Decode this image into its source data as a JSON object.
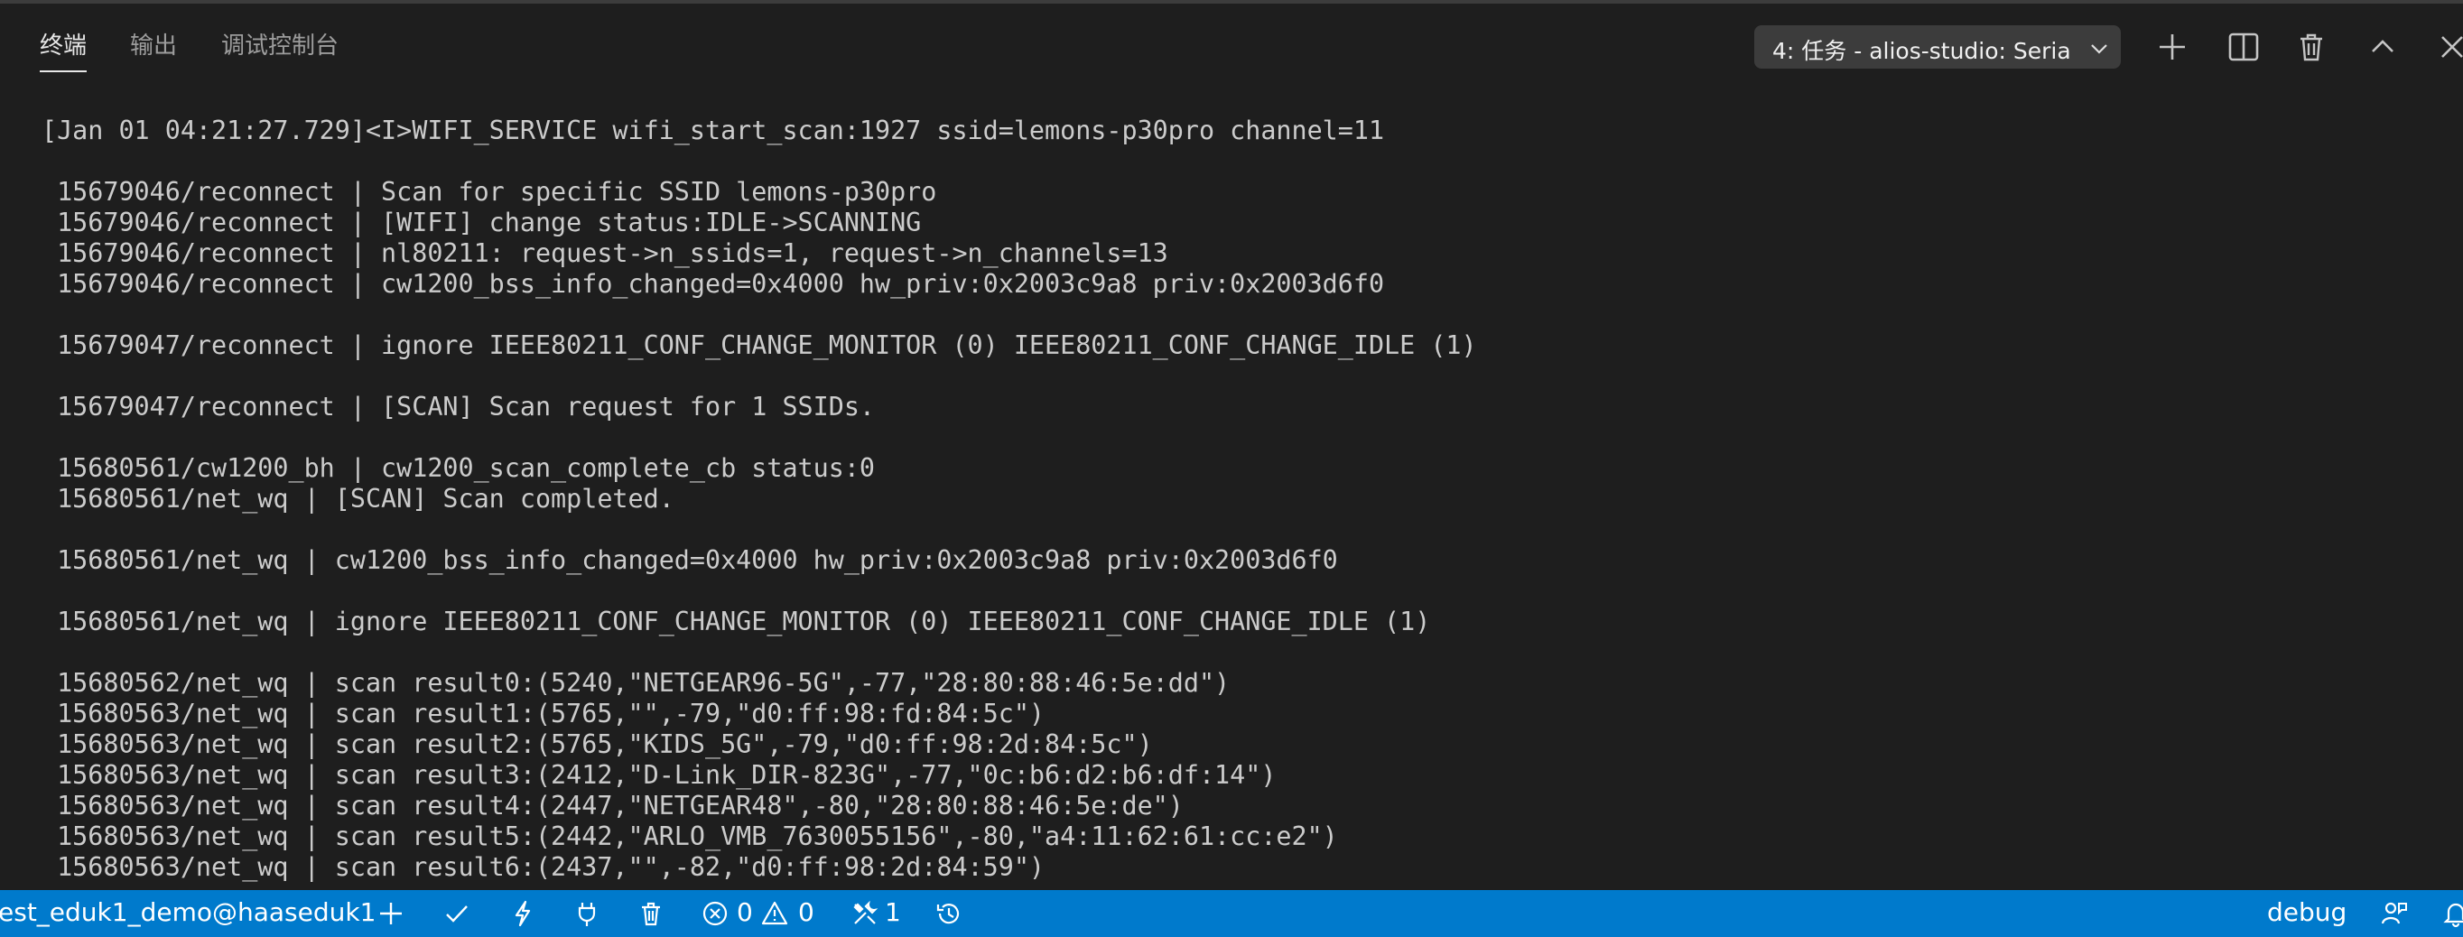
{
  "panel": {
    "tabs": [
      {
        "label": "终端",
        "active": true
      },
      {
        "label": "输出",
        "active": false
      },
      {
        "label": "调试控制台",
        "active": false
      }
    ],
    "task_select": {
      "value": "4: 任务 - alios-studio: Seria"
    },
    "toolbar_icons": [
      "plus-icon",
      "split-icon",
      "trash-icon",
      "chevron-up-icon",
      "close-icon"
    ]
  },
  "terminal": {
    "lines": [
      "[Jan 01 04:21:27.729]<I>WIFI_SERVICE wifi_start_scan:1927 ssid=lemons-p30pro channel=11",
      "",
      " 15679046/reconnect | Scan for specific SSID lemons-p30pro",
      " 15679046/reconnect | [WIFI] change status:IDLE->SCANNING",
      " 15679046/reconnect | nl80211: request->n_ssids=1, request->n_channels=13",
      " 15679046/reconnect | cw1200_bss_info_changed=0x4000 hw_priv:0x2003c9a8 priv:0x2003d6f0",
      "",
      " 15679047/reconnect | ignore IEEE80211_CONF_CHANGE_MONITOR (0) IEEE80211_CONF_CHANGE_IDLE (1)",
      "",
      " 15679047/reconnect | [SCAN] Scan request for 1 SSIDs.",
      "",
      " 15680561/cw1200_bh | cw1200_scan_complete_cb status:0",
      " 15680561/net_wq | [SCAN] Scan completed.",
      "",
      " 15680561/net_wq | cw1200_bss_info_changed=0x4000 hw_priv:0x2003c9a8 priv:0x2003d6f0",
      "",
      " 15680561/net_wq | ignore IEEE80211_CONF_CHANGE_MONITOR (0) IEEE80211_CONF_CHANGE_IDLE (1)",
      "",
      " 15680562/net_wq | scan result0:(5240,\"NETGEAR96-5G\",-77,\"28:80:88:46:5e:dd\")",
      " 15680563/net_wq | scan result1:(5765,\"\",-79,\"d0:ff:98:fd:84:5c\")",
      " 15680563/net_wq | scan result2:(5765,\"KIDS_5G\",-79,\"d0:ff:98:2d:84:5c\")",
      " 15680563/net_wq | scan result3:(2412,\"D-Link_DIR-823G\",-77,\"0c:b6:d2:b6:df:14\")",
      " 15680563/net_wq | scan result4:(2447,\"NETGEAR48\",-80,\"28:80:88:46:5e:de\")",
      " 15680563/net_wq | scan result5:(2442,\"ARLO_VMB_7630055156\",-80,\"a4:11:62:61:cc:e2\")",
      " 15680563/net_wq | scan result6:(2437,\"\",-82,\"d0:ff:98:2d:84:59\")"
    ]
  },
  "statusbar": {
    "project": "est_eduk1_demo@haaseduk1",
    "errors": "0",
    "warnings": "0",
    "tools_count": "1",
    "right_label": "debug",
    "background": "#007acc"
  }
}
